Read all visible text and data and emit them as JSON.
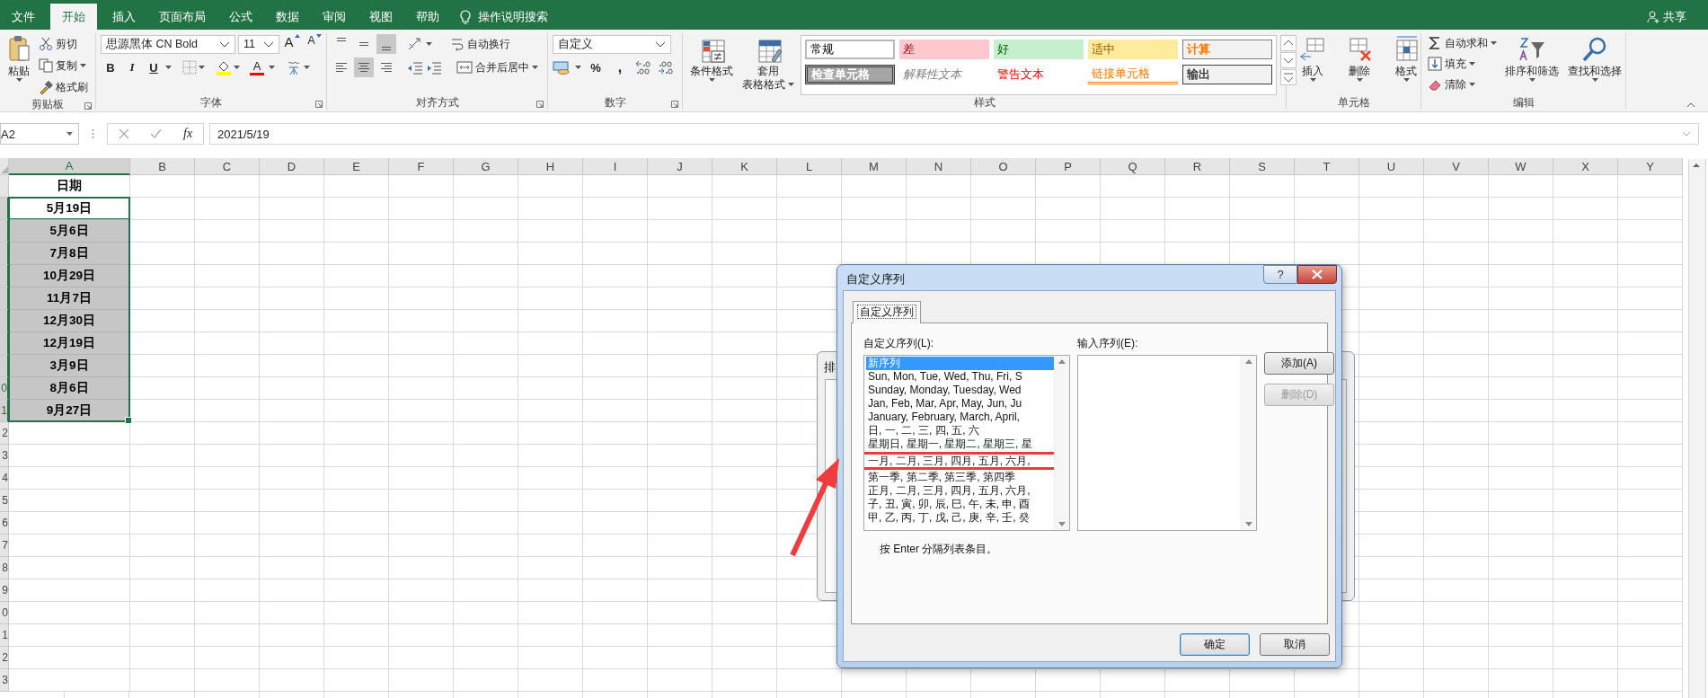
{
  "tabs": [
    {
      "label": "文件",
      "selected": false
    },
    {
      "label": "开始",
      "selected": true
    },
    {
      "label": "插入",
      "selected": false
    },
    {
      "label": "页面布局",
      "selected": false
    },
    {
      "label": "公式",
      "selected": false
    },
    {
      "label": "数据",
      "selected": false
    },
    {
      "label": "审阅",
      "selected": false
    },
    {
      "label": "视图",
      "selected": false
    },
    {
      "label": "帮助",
      "selected": false
    }
  ],
  "tell_me": "操作说明搜索",
  "share": "共享",
  "ribbon": {
    "clipboard": {
      "label": "剪贴板",
      "paste": "粘贴",
      "cut": "剪切",
      "copy": "复制",
      "format_painter": "格式刷"
    },
    "font": {
      "label": "字体",
      "font_name": "思源黑体 CN Bold",
      "font_size": "11",
      "grow": "A",
      "shrink": "A",
      "bold": "B",
      "italic": "I",
      "underline": "U",
      "font_color": "A"
    },
    "alignment": {
      "label": "对齐方式",
      "vertical": [
        {
          "selected": false
        },
        {
          "selected": false
        },
        {
          "selected": true
        }
      ],
      "horizontal": [
        {
          "selected": false
        },
        {
          "selected": true
        },
        {
          "selected": false
        }
      ],
      "wrap_text": "自动换行",
      "merge_center": "合并后居中"
    },
    "number": {
      "label": "数字",
      "format": "自定义",
      "percent": "%",
      "comma": ","
    },
    "styles": {
      "label": "样式",
      "conditional": "条件格式",
      "table_format": [
        "套用",
        "表格格式"
      ],
      "cell_styles": [
        {
          "label": "常规",
          "kind": "normal"
        },
        {
          "label": "差",
          "kind": "bad"
        },
        {
          "label": "好",
          "kind": "good"
        },
        {
          "label": "适中",
          "kind": "neutral"
        },
        {
          "label": "计算",
          "kind": "calculation"
        },
        {
          "label": "检查单元格",
          "kind": "check"
        },
        {
          "label": "解释性文本",
          "kind": "explanatory"
        },
        {
          "label": "警告文本",
          "kind": "warning"
        },
        {
          "label": "链接单元格",
          "kind": "linked"
        },
        {
          "label": "输出",
          "kind": "output"
        }
      ]
    },
    "cells": {
      "label": "单元格",
      "buttons": [
        "插入",
        "删除",
        "格式"
      ]
    },
    "editing": {
      "label": "编辑",
      "autosum": "自动求和",
      "fill": "填充",
      "clear": "清除",
      "sort": "排序和筛选",
      "find": "查找和选择"
    }
  },
  "formula_bar": {
    "name_box": "A2",
    "fx": "fx",
    "value": "2021/5/19"
  },
  "sheet": {
    "columns": [
      {
        "label": "A",
        "selected": true
      },
      {
        "label": "B",
        "selected": false
      },
      {
        "label": "C",
        "selected": false
      },
      {
        "label": "D",
        "selected": false
      },
      {
        "label": "E",
        "selected": false
      },
      {
        "label": "F",
        "selected": false
      },
      {
        "label": "G",
        "selected": false
      },
      {
        "label": "H",
        "selected": false
      },
      {
        "label": "I",
        "selected": false
      },
      {
        "label": "J",
        "selected": false
      },
      {
        "label": "K",
        "selected": false
      },
      {
        "label": "L",
        "selected": false
      },
      {
        "label": "M",
        "selected": false
      },
      {
        "label": "N",
        "selected": false
      },
      {
        "label": "O",
        "selected": false
      },
      {
        "label": "P",
        "selected": false
      },
      {
        "label": "Q",
        "selected": false
      },
      {
        "label": "R",
        "selected": false
      },
      {
        "label": "S",
        "selected": false
      },
      {
        "label": "T",
        "selected": false
      },
      {
        "label": "U",
        "selected": false
      },
      {
        "label": "V",
        "selected": false
      },
      {
        "label": "W",
        "selected": false
      },
      {
        "label": "X",
        "selected": false
      },
      {
        "label": "Y",
        "selected": false
      }
    ],
    "rows": [
      {
        "cell": "日期",
        "selected": false,
        "active": false
      },
      {
        "cell": "5月19日",
        "selected": true,
        "active": true
      },
      {
        "cell": "5月6日",
        "selected": true,
        "active": false
      },
      {
        "cell": "7月8日",
        "selected": true,
        "active": false
      },
      {
        "cell": "10月29日",
        "selected": true,
        "active": false
      },
      {
        "cell": "11月7日",
        "selected": true,
        "active": false
      },
      {
        "cell": "12月30日",
        "selected": true,
        "active": false
      },
      {
        "cell": "12月19日",
        "selected": true,
        "active": false
      },
      {
        "cell": "3月9日",
        "selected": true,
        "active": false
      },
      {
        "header": "0",
        "cell": "8月6日",
        "selected": true,
        "active": false
      },
      {
        "header": "1",
        "cell": "9月27日",
        "selected": true,
        "active": false
      },
      {
        "header": "2",
        "selected": false,
        "active": false
      },
      {
        "header": "3",
        "selected": false,
        "active": false
      },
      {
        "header": "4",
        "selected": false,
        "active": false
      },
      {
        "header": "5",
        "selected": false,
        "active": false
      },
      {
        "header": "6",
        "selected": false,
        "active": false
      },
      {
        "header": "7",
        "selected": false,
        "active": false
      },
      {
        "header": "8",
        "selected": false,
        "active": false
      },
      {
        "header": "9",
        "selected": false,
        "active": false
      },
      {
        "header": "0",
        "selected": false,
        "active": false
      },
      {
        "header": "1",
        "selected": false,
        "active": false
      },
      {
        "header": "2",
        "selected": false,
        "active": false
      },
      {
        "header": "3",
        "selected": false,
        "active": false
      }
    ]
  },
  "sort_dialog": {
    "title": "排"
  },
  "custom_lists_dialog": {
    "title": "自定义序列",
    "help": "?",
    "tab": "自定义序列",
    "lists_label": "自定义序列(L):",
    "lists": [
      {
        "text": "新序列",
        "selected": true,
        "highlighted": false
      },
      {
        "text": "Sun, Mon, Tue, Wed, Thu, Fri, S",
        "selected": false,
        "highlighted": false
      },
      {
        "text": "Sunday, Monday, Tuesday, Wed",
        "selected": false,
        "highlighted": false
      },
      {
        "text": "Jan, Feb, Mar, Apr, May, Jun, Ju",
        "selected": false,
        "highlighted": false
      },
      {
        "text": "January, February, March, April,",
        "selected": false,
        "highlighted": false
      },
      {
        "text": "日, 一, 二, 三, 四, 五, 六",
        "selected": false,
        "highlighted": false
      },
      {
        "text": "星期日, 星期一, 星期二, 星期三, 星",
        "selected": false,
        "highlighted": false
      },
      {
        "text": "一月, 二月, 三月, 四月, 五月, 六月,",
        "selected": false,
        "highlighted": true
      },
      {
        "text": "第一季, 第二季, 第三季, 第四季",
        "selected": false,
        "highlighted": false
      },
      {
        "text": "正月, 二月, 三月, 四月, 五月, 六月,",
        "selected": false,
        "highlighted": false
      },
      {
        "text": "子, 丑, 寅, 卯, 辰, 巳, 午, 未, 申, 酉",
        "selected": false,
        "highlighted": false
      },
      {
        "text": "甲, 乙, 丙, 丁, 戊, 己, 庚, 辛, 壬, 癸",
        "selected": false,
        "highlighted": false
      }
    ],
    "entries_label": "输入序列(E):",
    "add": {
      "label": "添加(A)",
      "disabled": false
    },
    "delete": {
      "label": "删除(D)",
      "disabled": true
    },
    "hint": "按 Enter 分隔列表条目。",
    "ok": "确定",
    "cancel": "取消"
  }
}
